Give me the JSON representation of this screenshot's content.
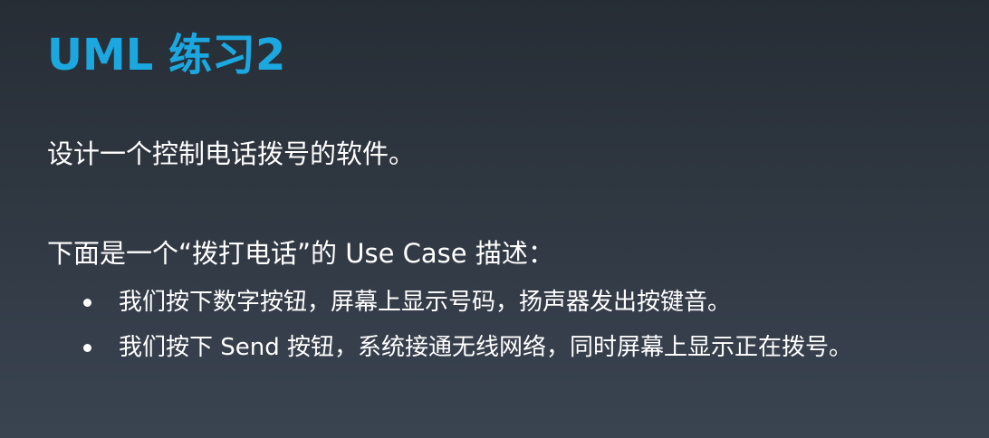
{
  "slide": {
    "title": "UML 练习2",
    "intro": "设计一个控制电话拨号的软件。",
    "usecase_heading": "下面是一个“拨打电话”的 Use Case 描述：",
    "bullets": [
      "我们按下数字按钮，屏幕上显示号码，扬声器发出按键音。",
      "我们按下 Send 按钮，系统接通无线网络，同时屏幕上显示正在拨号。"
    ]
  },
  "colors": {
    "title": "#1ba8e0",
    "text": "#ffffff",
    "background_top": "#262d35",
    "background_bottom": "#3a4451"
  }
}
